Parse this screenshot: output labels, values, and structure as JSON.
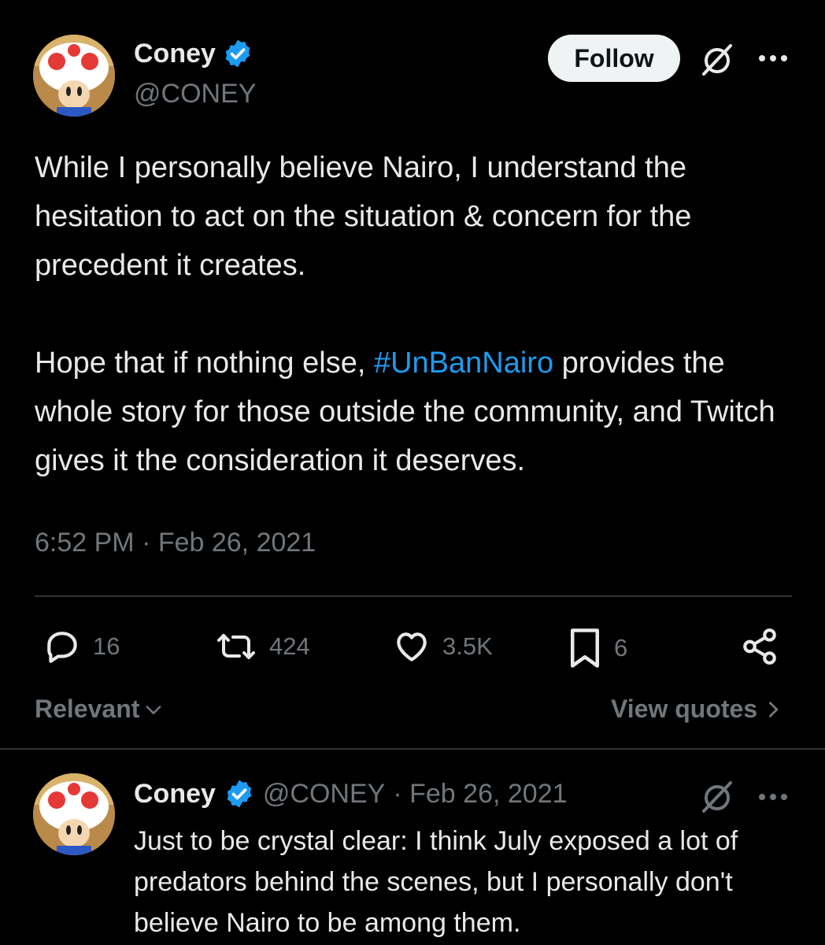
{
  "tweet": {
    "author_name": "Coney",
    "author_handle": "@CONEY",
    "follow_label": "Follow",
    "paragraph1": "While I personally believe Nairo, I understand the hesitation to act on the situation & concern for the precedent it creates.",
    "p2_before": "Hope that if nothing else, ",
    "p2_hashtag": "#UnBanNairo",
    "p2_after": " provides the whole story for those outside the community, and Twitch gives it the consideration it deserves.",
    "timestamp": "6:52 PM · Feb 26, 2021",
    "stats": {
      "replies": "16",
      "retweets": "424",
      "likes": "3.5K",
      "bookmarks": "6"
    }
  },
  "sort": {
    "label": "Relevant"
  },
  "view_quotes": {
    "label": "View quotes"
  },
  "reply": {
    "author_name": "Coney",
    "author_handle": "@CONEY",
    "date": "· Feb 26, 2021",
    "text": "Just to be crystal clear: I think July exposed a lot of predators behind the scenes, but I personally don't believe Nairo to be among them."
  },
  "colors": {
    "accent": "#1d9bf0",
    "muted": "#71767b",
    "text": "#e7e9ea"
  },
  "icons": [
    "verified-badge-icon",
    "grok-icon",
    "more-icon",
    "reply-icon",
    "retweet-icon",
    "like-icon",
    "bookmark-icon",
    "share-icon",
    "chevron-down-icon",
    "chevron-right-icon"
  ]
}
